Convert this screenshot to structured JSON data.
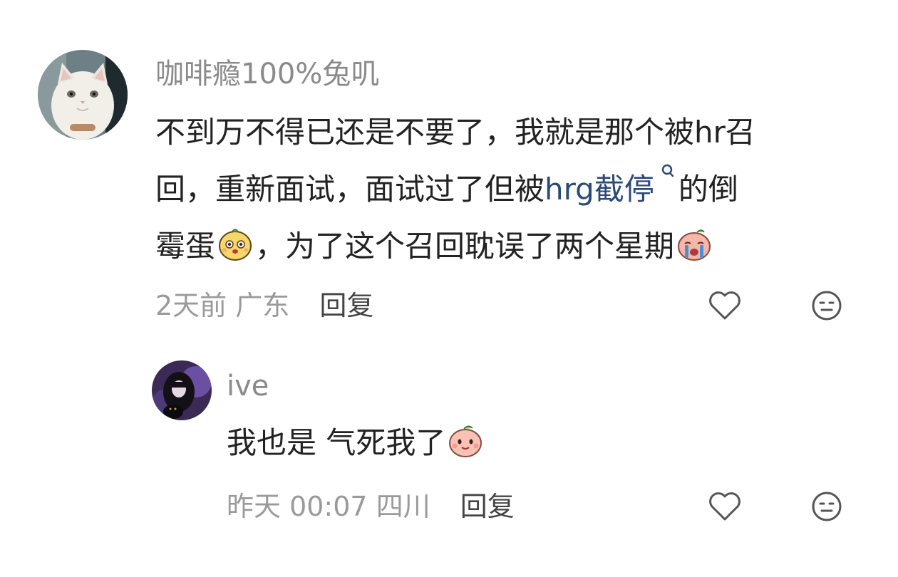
{
  "comments": [
    {
      "username": "咖啡瘾100%兔叽",
      "avatar_icon": "cat-avatar",
      "body_lines": [
        "不到万不得已还是不要了，我就是那个被hr召",
        [
          "回，重新面试，面试过了但被",
          "hrg截停",
          "的倒"
        ],
        [
          "霉蛋",
          "，为了这个召回耽误了两个星期"
        ]
      ],
      "emojis": [
        "smiling-mango-emoji",
        "crying-peach-emoji"
      ],
      "time": "2天前",
      "location": "广东",
      "reply_label": "回复",
      "like_icon": "heart-icon",
      "react_icon": "neutral-face-icon",
      "reply": {
        "username": "ive",
        "avatar_icon": "dark-girl-avatar",
        "body": "我也是 气死我了",
        "emojis": [
          "smiling-peach-emoji"
        ],
        "time": "昨天 00:07",
        "location": "四川",
        "reply_label": "回复",
        "like_icon": "heart-icon",
        "react_icon": "neutral-face-icon"
      }
    }
  ],
  "colors": {
    "username": "#8a8a8a",
    "body": "#222222",
    "link": "#2c4a78",
    "meta": "#9a9a9a",
    "reply_button": "#444444",
    "icon": "#555555"
  }
}
